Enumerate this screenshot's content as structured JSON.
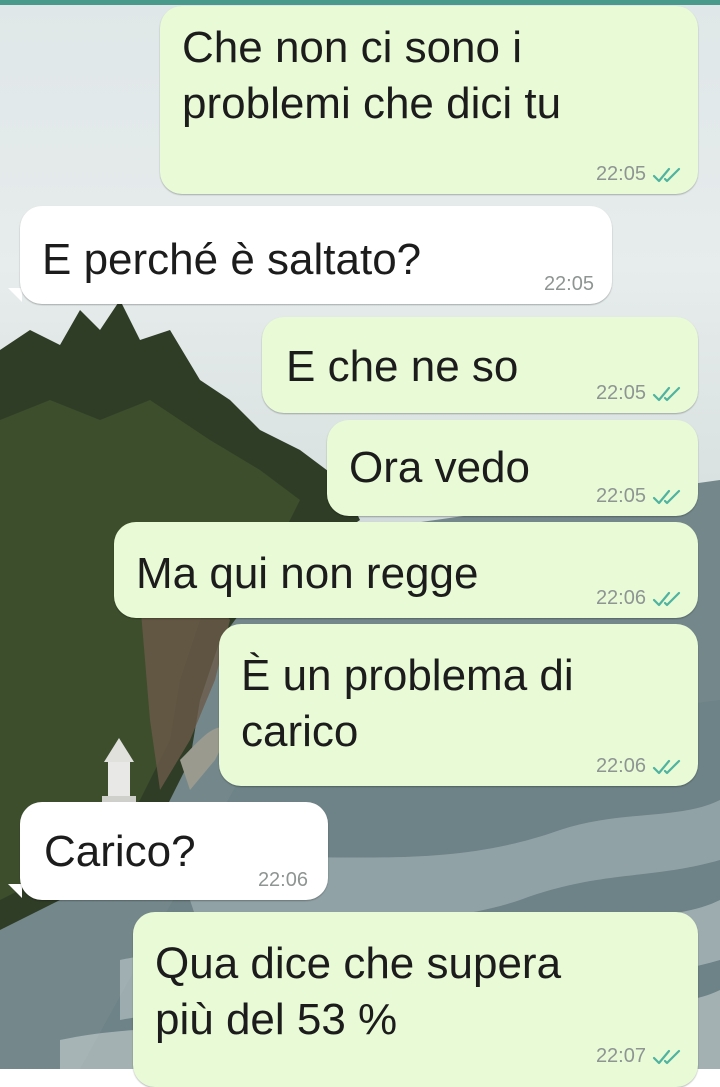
{
  "messages": [
    {
      "id": "m1",
      "direction": "out",
      "text": "Che non ci sono i\nproblemi che dici tu",
      "time": "22:05",
      "status": "double-check-icon"
    },
    {
      "id": "m2",
      "direction": "in",
      "text": "E perché è saltato?",
      "time": "22:05"
    },
    {
      "id": "m3",
      "direction": "out",
      "text": "E che ne so",
      "time": "22:05",
      "status": "double-check-icon"
    },
    {
      "id": "m4",
      "direction": "out",
      "text": "Ora vedo",
      "time": "22:05",
      "status": "double-check-icon"
    },
    {
      "id": "m5",
      "direction": "out",
      "text": "Ma qui non regge",
      "time": "22:06",
      "status": "double-check-icon"
    },
    {
      "id": "m6",
      "direction": "out",
      "text": "È un problema di\ncarico",
      "time": "22:06",
      "status": "double-check-icon"
    },
    {
      "id": "m7",
      "direction": "in",
      "text": "Carico?",
      "time": "22:06"
    },
    {
      "id": "m8",
      "direction": "out",
      "text": "Qua dice che supera\npiù del 53 %",
      "time": "22:07",
      "status": "double-check-icon"
    }
  ],
  "colors": {
    "outgoing": "#e8fad6",
    "incoming": "#ffffff",
    "tick": "#4fb3a0",
    "topbar": "#4a9a8c"
  }
}
